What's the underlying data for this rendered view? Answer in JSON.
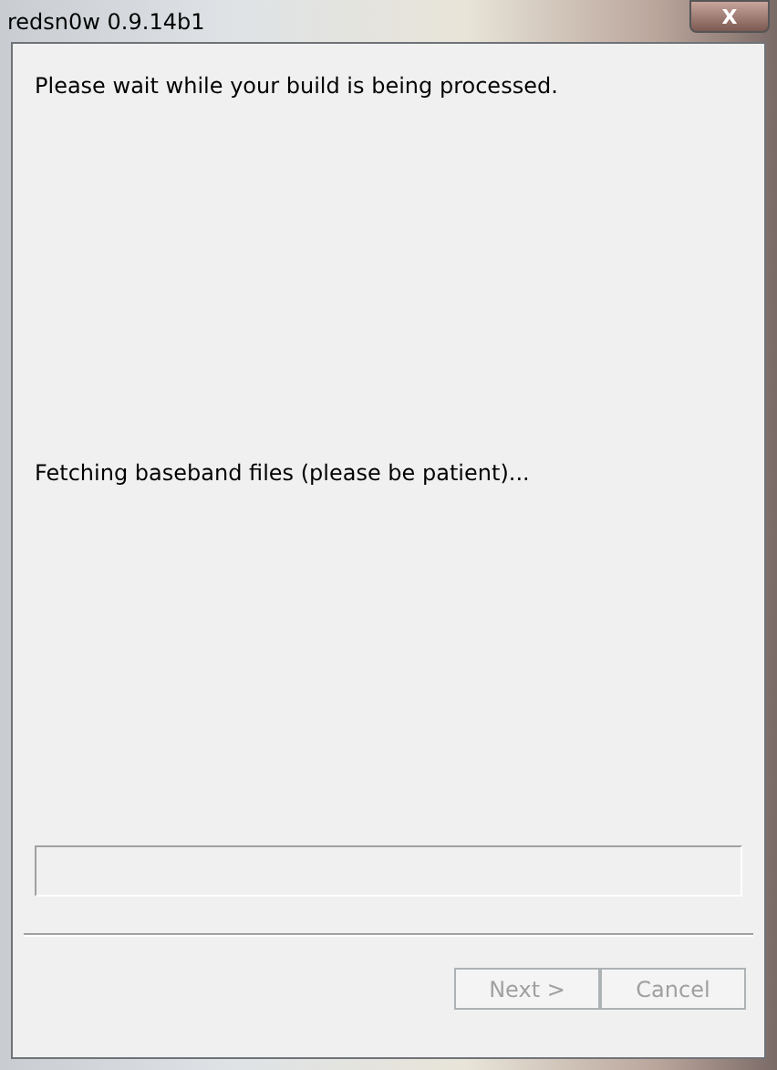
{
  "window": {
    "title": "redsn0w 0.9.14b1",
    "close_button": "X"
  },
  "header": "Please wait while your build is being processed.",
  "status": "Fetching baseband files (please be patient)...",
  "progress": {
    "level": 0
  },
  "buttons": [
    {
      "label": "Next >",
      "disabled": true
    },
    {
      "label": "Cancel",
      "disabled": true
    }
  ]
}
